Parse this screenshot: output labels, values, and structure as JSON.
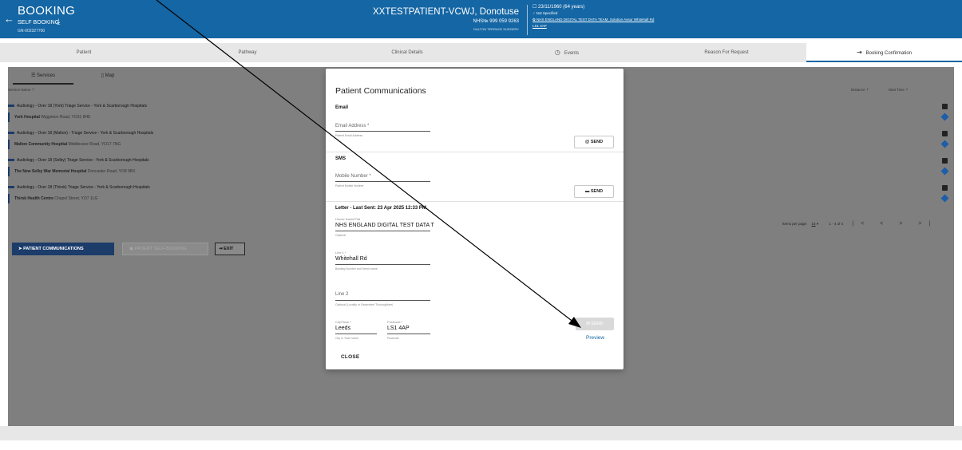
{
  "header": {
    "back_icon": "arrow-left-icon",
    "title": "BOOKING",
    "subtitle": "SELF BOOKING",
    "download_icon": "download-icon",
    "booking_id": "GN-002327700",
    "patient_name": "XXTESTPATIENT-VCWJ, Donotuse",
    "nhs_number": "NHS№ 999 059 9263",
    "surgery": "DALTON TERRACE SURGERY",
    "dob": "☐ 23/11/1960 (64 years)",
    "gender": "♂ Not Specified",
    "organisation": "✿ NHS ENGLAND DIGITAL TEST DATA TEAM, Solution Assur Whitehall Rd",
    "postcode": "LS1 4AP",
    "color": "#1466a4"
  },
  "tabs": [
    {
      "label": "Patient"
    },
    {
      "label": "Pathway"
    },
    {
      "label": "Clinical Details"
    },
    {
      "label": "Events",
      "icon": "history-icon"
    },
    {
      "label": "Reason For Request"
    },
    {
      "label": "Booking Confirmation",
      "icon": "exit-icon",
      "active": true
    }
  ],
  "subtabs": {
    "services": "Services",
    "map": "Map"
  },
  "list": {
    "col_service": "Service Name ⇡",
    "col_distance": "Distance ⇡",
    "col_wait": "Wait Time ⇡",
    "rows": [
      {
        "service": "Audiology - Over 18 (York) Triage Service - York & Scarborough Hospitals",
        "location": "York Hospital",
        "address": " Wigginton Road, YO31 8HE"
      },
      {
        "service": "Audiology - Over 18 (Malton) - Triage Service - York & Scarborough Hospitals",
        "location": "Malton Community Hospital",
        "address": " Middlecave Road, YO17 7NG"
      },
      {
        "service": "Audiology - Over 18 (Selby) Triage Service - York & Scarborough Hospitals",
        "location": "The New Selby War Memorial Hospital",
        "address": " Doncaster Road, YO8 9BX"
      },
      {
        "service": "Audiology - Over 18 (Thirsk) Triage Service - York & Scarborough Hospitals",
        "location": "Thirsk Health Centre",
        "address": " Chapel Street, YO7 1LG"
      }
    ]
  },
  "pager": {
    "items_per_page_label": "Items per page:",
    "items_per_page": "15",
    "range": "1 - 4 of 4",
    "nav": "|<  <  >  >|"
  },
  "actions": {
    "patient_communications": "PATIENT COMMUNICATIONS",
    "patient_self_booking": "PATIENT SELF-BOOKING",
    "exit": "EXIT"
  },
  "modal": {
    "title": "Patient Communications",
    "email": {
      "section": "Email",
      "label": "Email Address *",
      "hint": "Patient Email Address",
      "send": "SEND"
    },
    "sms": {
      "section": "SMS",
      "label": "Mobile Number *",
      "hint": "Patient Mobile Number",
      "send": "SEND"
    },
    "letter": {
      "section": "Letter - Last Sent: 23 Apr 2025 12:33 PM",
      "house_label": "House Name/Flat",
      "house_value": "NHS ENGLAND DIGITAL TEST DATA T",
      "house_hint": "Optional",
      "line1_label": "Line 1 *",
      "line1_value": "Whitehall Rd",
      "line1_hint": "Building Number and Street name",
      "line2_label": "Line 2",
      "line2_hint": "Optional (Locality or Dependent Thoroughfare)",
      "city_label": "City/Town *",
      "city_value": "Leeds",
      "city_hint": "City or Town name",
      "postcode_label": "Postcode *",
      "postcode_value": "LS1 4AP",
      "postcode_hint": "Postcode",
      "send": "SEND",
      "preview": "Preview"
    },
    "close": "CLOSE"
  }
}
